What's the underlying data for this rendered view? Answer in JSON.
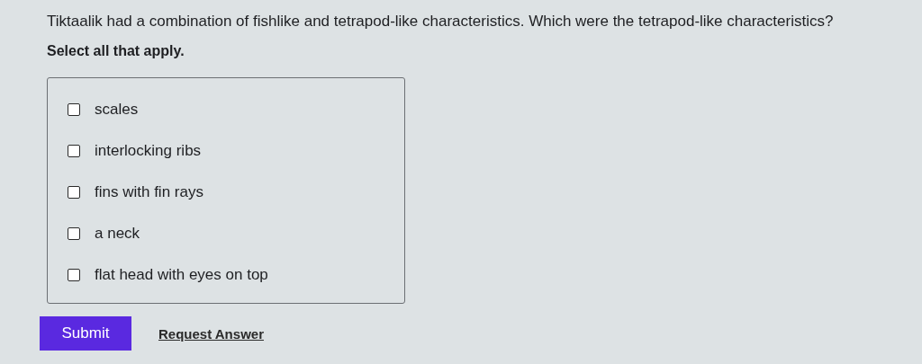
{
  "question": "Tiktaalik had a combination of fishlike and tetrapod-like characteristics. Which were the tetrapod-like characteristics?",
  "instruction": "Select all that apply.",
  "options": [
    {
      "label": "scales",
      "checked": false
    },
    {
      "label": "interlocking ribs",
      "checked": false
    },
    {
      "label": "fins with fin rays",
      "checked": false
    },
    {
      "label": "a neck",
      "checked": false
    },
    {
      "label": "flat head with eyes on top",
      "checked": false
    }
  ],
  "submit": "Submit",
  "request_answer": "Request Answer"
}
